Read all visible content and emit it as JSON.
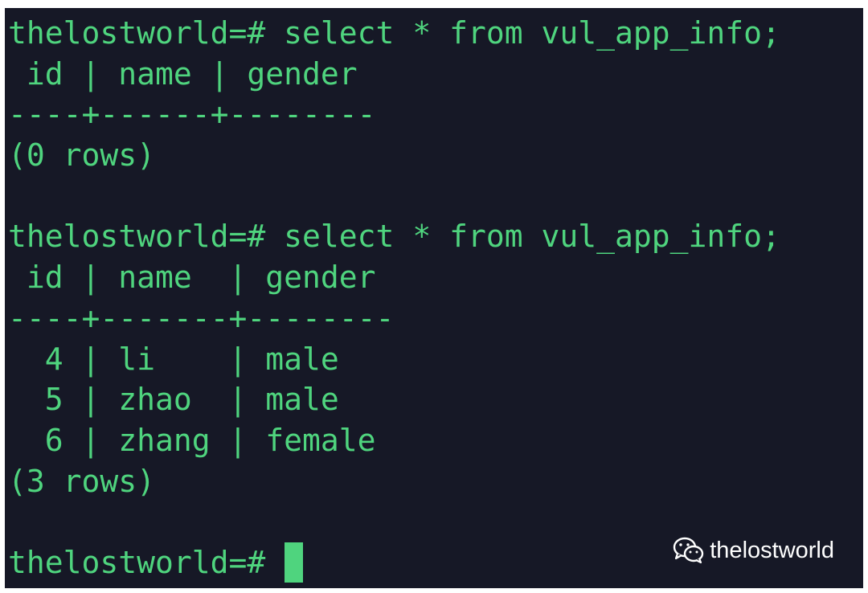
{
  "terminal": {
    "lines": [
      "thelostworld=# select * from vul_app_info;",
      " id | name | gender",
      "----+------+--------",
      "(0 rows)",
      "",
      "thelostworld=# select * from vul_app_info;",
      " id | name  | gender",
      "----+-------+--------",
      "  4 | li    | male",
      "  5 | zhao  | male",
      "  6 | zhang | female",
      "(3 rows)",
      ""
    ],
    "prompt": "thelostworld=# "
  },
  "watermark": {
    "icon": "wechat-icon",
    "text": "thelostworld"
  },
  "colors": {
    "background": "#161826",
    "text": "#4fd47e",
    "cursor": "#4fd47e"
  }
}
